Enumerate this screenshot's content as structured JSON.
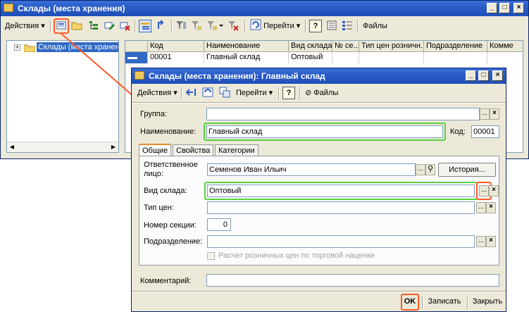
{
  "main_window": {
    "title": "Склады (места хранения)",
    "toolbar": {
      "actions_label": "Действия",
      "goto_label": "Перейти",
      "help_label": "?",
      "files_label": "Файлы"
    },
    "tree": {
      "root_label": "Склады (места хранения)"
    },
    "grid": {
      "columns": [
        "Код",
        "Наименование",
        "Вид склада",
        "№ се...",
        "Тип цен розничн...",
        "Подразделение",
        "Комме"
      ],
      "rows": [
        [
          "00001",
          "Главный склад",
          "Оптовый",
          "",
          "",
          "",
          ""
        ]
      ]
    },
    "controls": {
      "minimize": "_",
      "maximize": "□",
      "close": "×"
    }
  },
  "dialog": {
    "title": "Склады (места хранения): Главный склад",
    "toolbar": {
      "actions_label": "Действия",
      "goto_label": "Перейти",
      "help_label": "?",
      "files_label": "Файлы"
    },
    "controls": {
      "minimize": "_",
      "maximize": "□",
      "close": "×"
    },
    "group_label": "Группа:",
    "group_value": "",
    "name_label": "Наименование:",
    "name_value": "Главный склад",
    "code_label": "Код:",
    "code_value": "00001",
    "tabs": [
      "Общие",
      "Свойства",
      "Категории"
    ],
    "responsible_label": "Ответственное лицо:",
    "responsible_value": "Семенов Иван Ильич",
    "history_button": "История...",
    "warehouse_type_label": "Вид склада:",
    "warehouse_type_value": "Оптовый",
    "price_type_label": "Тип цен:",
    "price_type_value": "",
    "section_label": "Номер секции:",
    "section_value": "0",
    "department_label": "Подразделение:",
    "department_value": "",
    "retail_checkbox_label": "Расчет розничных цен по торговой наценке",
    "comment_label": "Комментарий:",
    "comment_value": "",
    "ok_button": "OK",
    "save_button": "Записать",
    "close_button": "Закрыть",
    "picker_glyph": "...",
    "clear_glyph": "×",
    "search_glyph": "⚲"
  },
  "colors": {
    "highlight_green": "#55d33c",
    "highlight_red": "#ff5a2a",
    "title_blue": "#2a5cc8"
  }
}
